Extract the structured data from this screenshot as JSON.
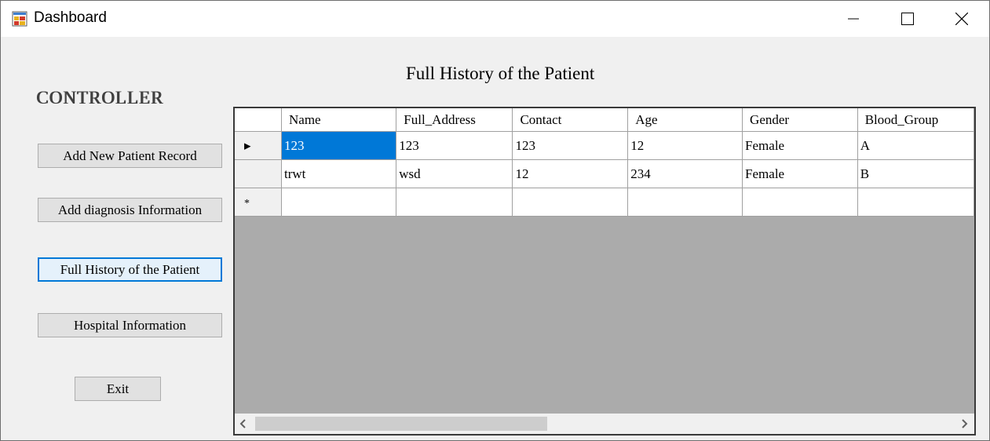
{
  "window": {
    "title": "Dashboard",
    "icon": "windows-form-icon",
    "controls": [
      "minimize-icon",
      "maximize-icon",
      "close-icon"
    ]
  },
  "heading": "Full History of the Patient",
  "sidebar": {
    "title": "CONTROLLER",
    "buttons": {
      "add_patient": "Add New Patient Record",
      "add_diagnosis": "Add diagnosis Information",
      "full_history": "Full History of the Patient",
      "hospital_info": "Hospital Information",
      "exit": "Exit"
    }
  },
  "grid": {
    "columns": [
      "Name",
      "Full_Address",
      "Contact",
      "Age",
      "Gender",
      "Blood_Group"
    ],
    "rows": [
      [
        "123",
        "123",
        "123",
        "12",
        "Female",
        "A"
      ],
      [
        "trwt",
        "wsd",
        "12",
        "234",
        "Female",
        "B"
      ]
    ],
    "current_row_indicator": "▸",
    "new_row_indicator": "*",
    "selected_color": "#0078d7",
    "empty_area_color": "#ababab"
  }
}
